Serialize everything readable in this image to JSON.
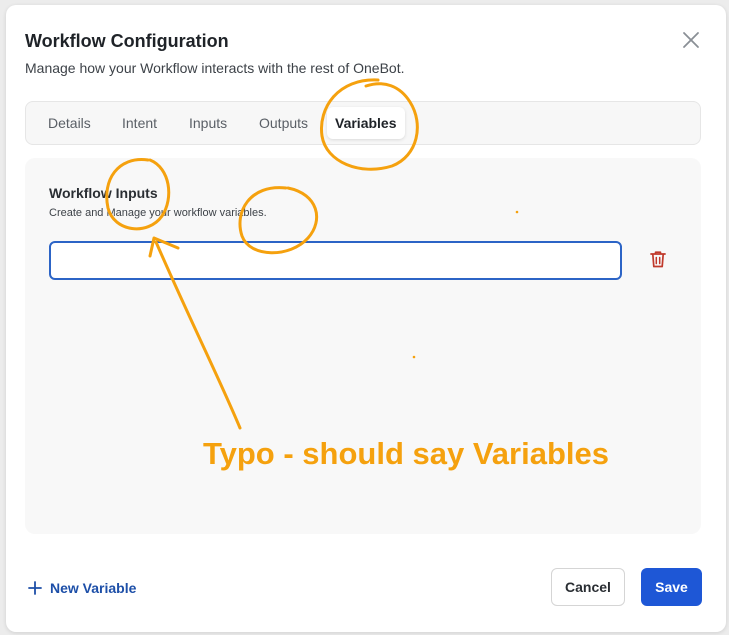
{
  "dialog": {
    "title": "Workflow Configuration",
    "subtitle": "Manage how your Workflow interacts with the rest of OneBot."
  },
  "tabs": [
    {
      "label": "Details"
    },
    {
      "label": "Intent"
    },
    {
      "label": "Inputs"
    },
    {
      "label": "Outputs"
    },
    {
      "label": "Variables"
    }
  ],
  "active_tab": "Variables",
  "section": {
    "title": "Workflow Inputs",
    "subtitle": "Create and Manage your workflow variables."
  },
  "variable_input": {
    "value": "",
    "placeholder": ""
  },
  "footer": {
    "new_variable_label": "New Variable",
    "cancel_label": "Cancel",
    "save_label": "Save"
  },
  "annotation": {
    "text": "Typo - should say Variables",
    "color": "#f5a10e"
  },
  "colors": {
    "accent": "#1e57d6",
    "link": "#1d4fa8",
    "danger": "#c0392b",
    "focus_border": "#2c64c6"
  },
  "icons": {
    "close": "close-icon",
    "trash": "trash-icon",
    "plus": "plus-icon"
  }
}
